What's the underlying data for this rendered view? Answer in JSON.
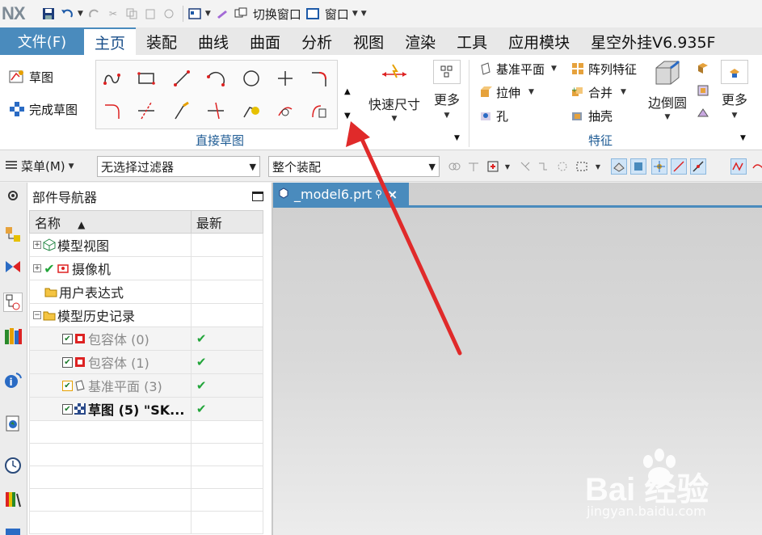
{
  "quick_access": {
    "logo": "NX",
    "switch_window_label": "切换窗口",
    "window_label": "窗口"
  },
  "tabs": {
    "file": "文件(F)",
    "items": [
      "主页",
      "装配",
      "曲线",
      "曲面",
      "分析",
      "视图",
      "渲染",
      "工具",
      "应用模块",
      "星空外挂V6.935F"
    ],
    "active_index": 0
  },
  "ribbon": {
    "sketch_btn": "草图",
    "finish_sketch_btn": "完成草图",
    "direct_sketch_group": "直接草图",
    "quick_dimension": "快速尺寸",
    "more": "更多",
    "datum_plane": "基准平面",
    "extrude": "拉伸",
    "hole": "孔",
    "pattern_feature": "阵列特征",
    "unite": "合并",
    "shell": "抽壳",
    "edge_blend": "边倒圆",
    "more2": "更多",
    "feature_group": "特征"
  },
  "toolbar": {
    "menu": "菜单(M)",
    "filter_value": "无选择过滤器",
    "scope_value": "整个装配"
  },
  "navigator": {
    "title": "部件导航器",
    "col_name": "名称",
    "col_latest": "最新",
    "rows": [
      {
        "label": "模型视图",
        "latest": ""
      },
      {
        "label": "摄像机",
        "latest": ""
      },
      {
        "label": "用户表达式",
        "latest": ""
      },
      {
        "label": "模型历史记录",
        "latest": ""
      },
      {
        "label": "包容体 (0)",
        "latest": "✔"
      },
      {
        "label": "包容体 (1)",
        "latest": "✔"
      },
      {
        "label": "基准平面 (3)",
        "latest": "✔"
      },
      {
        "label": "草图 (5) \"SK...",
        "latest": "✔"
      }
    ]
  },
  "graphics": {
    "tab_label": "_model6.prt",
    "tab_close": "×"
  },
  "watermark": {
    "brand": "Bai 经验",
    "url": "jingyan.baidu.com"
  },
  "colors": {
    "accent": "#4a8bbd",
    "arrow": "#e02a2a",
    "check": "#22a53a"
  }
}
